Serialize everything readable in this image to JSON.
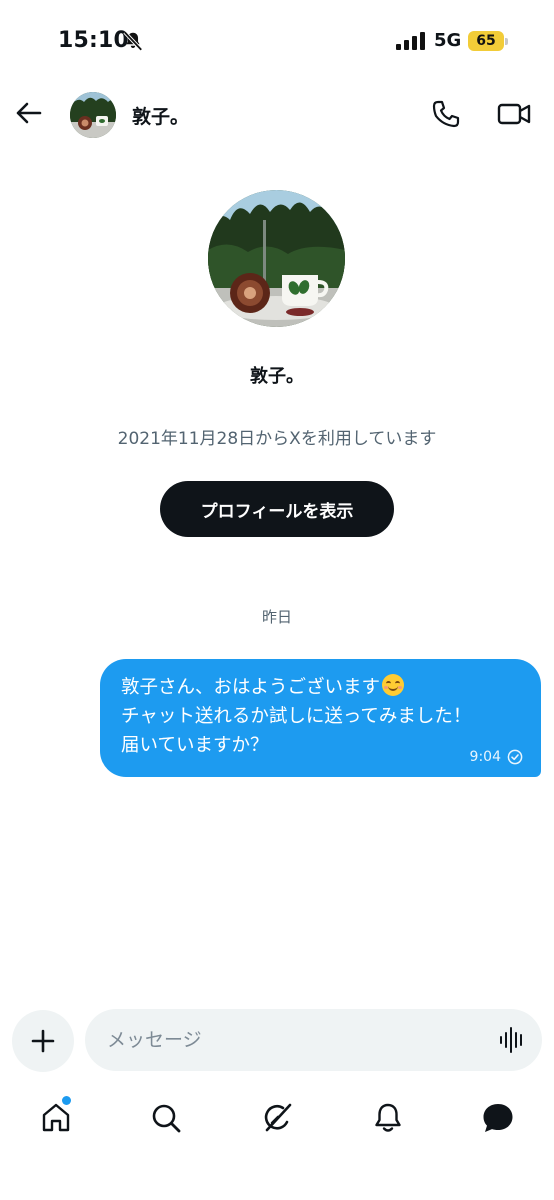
{
  "status_bar": {
    "time": "15:10",
    "network": "5G",
    "battery": "65"
  },
  "header": {
    "name": "敦子。"
  },
  "profile": {
    "name": "敦子。",
    "joined": "2021年11月28日からXを利用しています",
    "view_profile_label": "プロフィールを表示"
  },
  "conversation": {
    "date_divider": "昨日",
    "messages": [
      {
        "line1": "敦子さん、おはようございます",
        "line2": "チャット送れるか試しに送ってみました！",
        "line3": "届いていますか？",
        "emoji": "smiling-face-emoji",
        "time": "9:04",
        "status_icon": "read-check-icon"
      }
    ]
  },
  "composer": {
    "placeholder": "メッセージ"
  },
  "icons": {
    "back": "arrow-left-icon",
    "call": "phone-icon",
    "video": "video-camera-icon",
    "add": "plus-icon",
    "voice": "voice-wave-icon",
    "nav": [
      "home-icon",
      "search-icon",
      "grok-icon",
      "bell-icon",
      "messages-icon"
    ]
  },
  "colors": {
    "accent": "#1d9bf0",
    "text": "#0f1419",
    "secondary_text": "#536471",
    "input_bg": "#eff3f4",
    "battery": "#f2cc38"
  }
}
